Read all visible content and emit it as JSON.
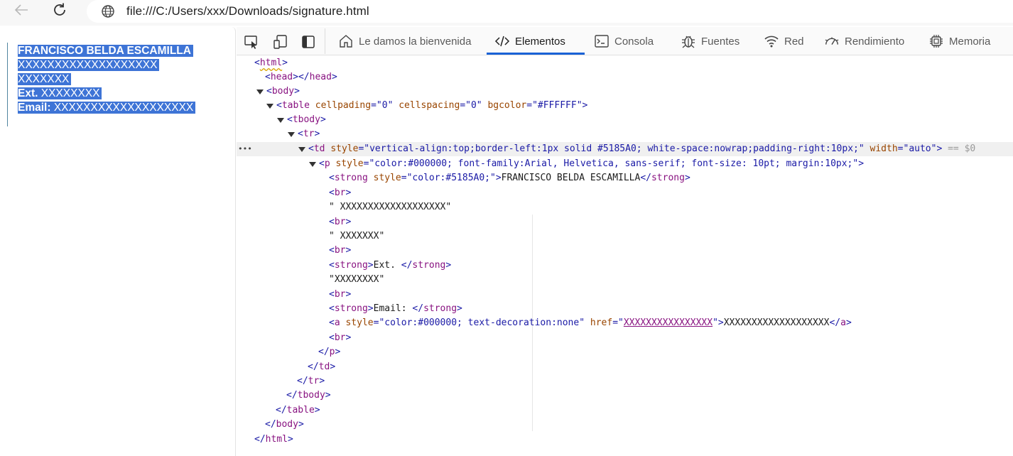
{
  "browser": {
    "url": "file:///C:/Users/xxx/Downloads/signature.html"
  },
  "signature": {
    "name": "FRANCISCO BELDA ESCAMILLA",
    "line2": "XXXXXXXXXXXXXXXXXXX",
    "line3": "XXXXXXX",
    "ext_label": "Ext.",
    "ext_value": "XXXXXXXX",
    "email_label": "Email:",
    "email_value": "XXXXXXXXXXXXXXXXXXX",
    "border_color": "#5185A0",
    "highlight_color": "#3e74d6"
  },
  "devtools": {
    "tabs": [
      {
        "label": "Le damos la bienvenida",
        "icon": "home-icon"
      },
      {
        "label": "Elementos",
        "icon": "code-icon",
        "active": true
      },
      {
        "label": "Consola",
        "icon": "console-icon"
      },
      {
        "label": "Fuentes",
        "icon": "bug-icon"
      },
      {
        "label": "Red",
        "icon": "wifi-icon"
      },
      {
        "label": "Rendimiento",
        "icon": "gauge-icon"
      },
      {
        "label": "Memoria",
        "icon": "chip-icon"
      }
    ],
    "dom": {
      "html": "html",
      "head": "head",
      "body": "body",
      "table": "table",
      "table_attrs": [
        {
          "name": "cellpading",
          "value": "0"
        },
        {
          "name": "cellspacing",
          "value": "0"
        },
        {
          "name": "bgcolor",
          "value": "#FFFFFF"
        }
      ],
      "tbody": "tbody",
      "tr": "tr",
      "td": "td",
      "td_style_name": "style",
      "td_style_value": "vertical-align:top;border-left:1px solid #5185A0;  white-space:nowrap;padding-right:10px;",
      "td_width_name": "width",
      "td_width_value": "auto",
      "td_suffix": "== $0",
      "p": "p",
      "p_style_name": "style",
      "p_style_value": "color:#000000; font-family:Arial, Helvetica, sans-serif; font-size: 10pt; margin:10px;",
      "strong": "strong",
      "strong_style_name": "style",
      "strong_style_value": "color:#5185A0;",
      "strong_text": "FRANCISCO BELDA ESCAMILLA",
      "br": "br",
      "text1": "\" XXXXXXXXXXXXXXXXXXX\"",
      "text2": "\" XXXXXXX\"",
      "ext_text": "Ext. ",
      "text3": "\"XXXXXXXX\"",
      "email_text": "Email: ",
      "a": "a",
      "a_style_name": "style",
      "a_style_value": "color:#000000; text-decoration:none",
      "a_href_name": "href",
      "a_href_value": "XXXXXXXXXXXXXXXX",
      "a_text": "XXXXXXXXXXXXXXXXXXX",
      "ellipsis": "•••"
    }
  }
}
